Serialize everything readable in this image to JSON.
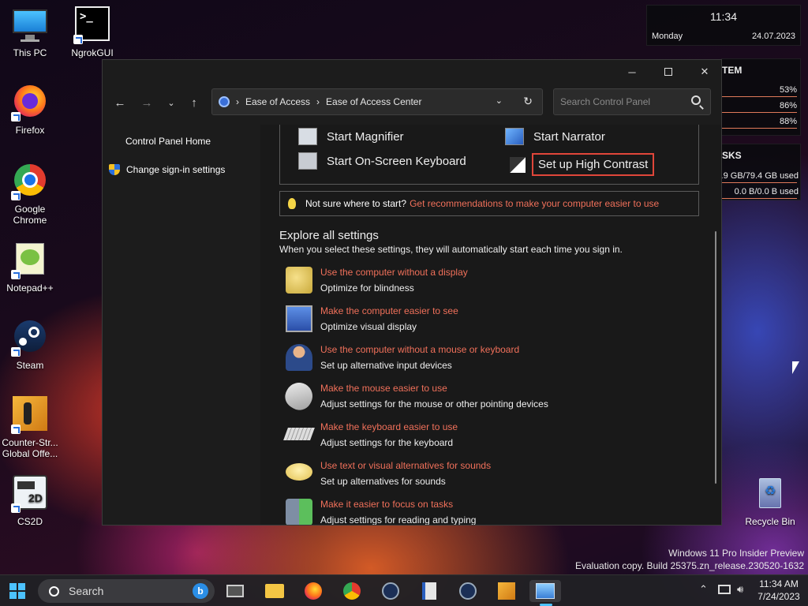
{
  "desktop": {
    "icons": [
      {
        "label": "This PC"
      },
      {
        "label": "NgrokGUI"
      },
      {
        "label": "Firefox"
      },
      {
        "label": "Google Chrome"
      },
      {
        "label": "Notepad++"
      },
      {
        "label": "Steam"
      },
      {
        "label": "Counter-Str... Global Offe..."
      },
      {
        "label": "CS2D"
      },
      {
        "label": "Recycle Bin"
      }
    ],
    "watermark_line1": "Windows 11 Pro Insider Preview",
    "watermark_line2": "Evaluation copy. Build 25375.zn_release.230520-1632"
  },
  "widgets": {
    "clock": {
      "time": "11:34",
      "day": "Monday",
      "date": "24.07.2023"
    },
    "system": {
      "title": "TEM",
      "values": [
        "53%",
        "86%",
        "88%"
      ]
    },
    "disks": {
      "title": "SKS",
      "used": ".9 GB/79.4 GB used",
      "used2": "0.0 B/0.0 B used"
    }
  },
  "window": {
    "breadcrumb": [
      "Ease of Access",
      "Ease of Access Center"
    ],
    "search_placeholder": "Search Control Panel",
    "sidebar": [
      "Control Panel Home",
      "Change sign-in settings"
    ],
    "tools": [
      "Start Magnifier",
      "Start Narrator",
      "Start On-Screen Keyboard",
      "Set up High Contrast"
    ],
    "hint_prefix": "Not sure where to start?",
    "hint_link": "Get recommendations to make your computer easier to use",
    "explore_title": "Explore all settings",
    "explore_desc": "When you select these settings, they will automatically start each time you sign in.",
    "settings": [
      {
        "title": "Use the computer without a display",
        "desc": "Optimize for blindness"
      },
      {
        "title": "Make the computer easier to see",
        "desc": "Optimize visual display"
      },
      {
        "title": "Use the computer without a mouse or keyboard",
        "desc": "Set up alternative input devices"
      },
      {
        "title": "Make the mouse easier to use",
        "desc": "Adjust settings for the mouse or other pointing devices"
      },
      {
        "title": "Make the keyboard easier to use",
        "desc": "Adjust settings for the keyboard"
      },
      {
        "title": "Use text or visual alternatives for sounds",
        "desc": "Set up alternatives for sounds"
      },
      {
        "title": "Make it easier to focus on tasks",
        "desc": "Adjust settings for reading and typing"
      }
    ]
  },
  "taskbar": {
    "search_label": "Search",
    "time": "11:34 AM",
    "date": "7/24/2023"
  },
  "colors": {
    "link": "#f0705a",
    "highlight_border": "#e0463a",
    "window_bg": "#191919"
  }
}
